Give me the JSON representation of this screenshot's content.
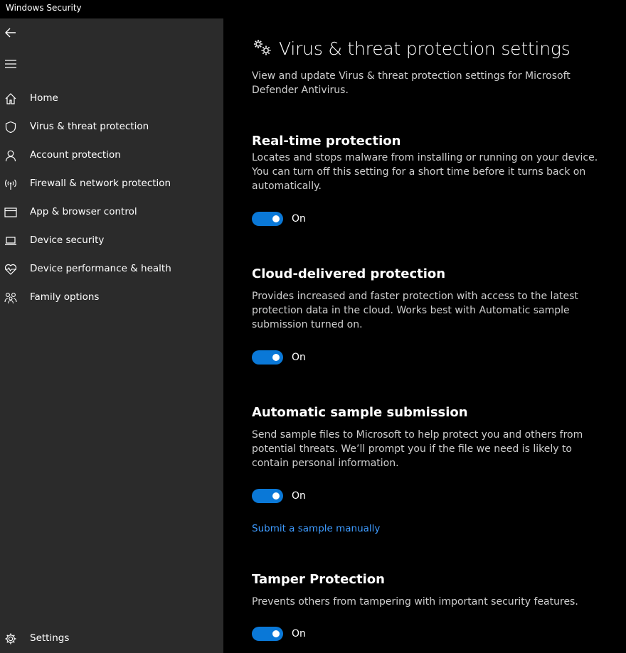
{
  "window": {
    "title": "Windows Security"
  },
  "sidebar": {
    "back_icon": "back-arrow-icon",
    "menu_icon": "hamburger-menu-icon",
    "items": [
      {
        "label": "Home",
        "icon": "home-icon"
      },
      {
        "label": "Virus & threat protection",
        "icon": "shield-icon"
      },
      {
        "label": "Account protection",
        "icon": "person-icon"
      },
      {
        "label": "Firewall & network protection",
        "icon": "wireless-antenna-icon"
      },
      {
        "label": "App & browser control",
        "icon": "browser-window-icon"
      },
      {
        "label": "Device security",
        "icon": "laptop-icon"
      },
      {
        "label": "Device performance & health",
        "icon": "heart-pulse-icon"
      },
      {
        "label": "Family options",
        "icon": "family-icon"
      }
    ],
    "settings": {
      "label": "Settings",
      "icon": "gear-icon"
    }
  },
  "main": {
    "header_icon": "gears-icon",
    "title": "Virus & threat protection settings",
    "description": "View and update Virus & threat protection settings for Microsoft Defender Antivirus.",
    "sections": [
      {
        "title": "Real-time protection",
        "description": "Locates and stops malware from installing or running on your device. You can turn off this setting for a short time before it turns back on automatically.",
        "toggle_state": "On"
      },
      {
        "title": "Cloud-delivered protection",
        "description": "Provides increased and faster protection with access to the latest protection data in the cloud. Works best with Automatic sample submission turned on.",
        "toggle_state": "On"
      },
      {
        "title": "Automatic sample submission",
        "description": "Send sample files to Microsoft to help protect you and others from potential threats. We’ll prompt you if the file we need is likely to contain personal information.",
        "toggle_state": "On",
        "link": "Submit a sample manually"
      },
      {
        "title": "Tamper Protection",
        "description": "Prevents others from tampering with important security features.",
        "toggle_state": "On"
      }
    ]
  },
  "colors": {
    "sidebar_bg": "#2b2b2b",
    "main_bg": "#000000",
    "toggle_on": "#0a78d7",
    "link": "#3e9bff"
  }
}
